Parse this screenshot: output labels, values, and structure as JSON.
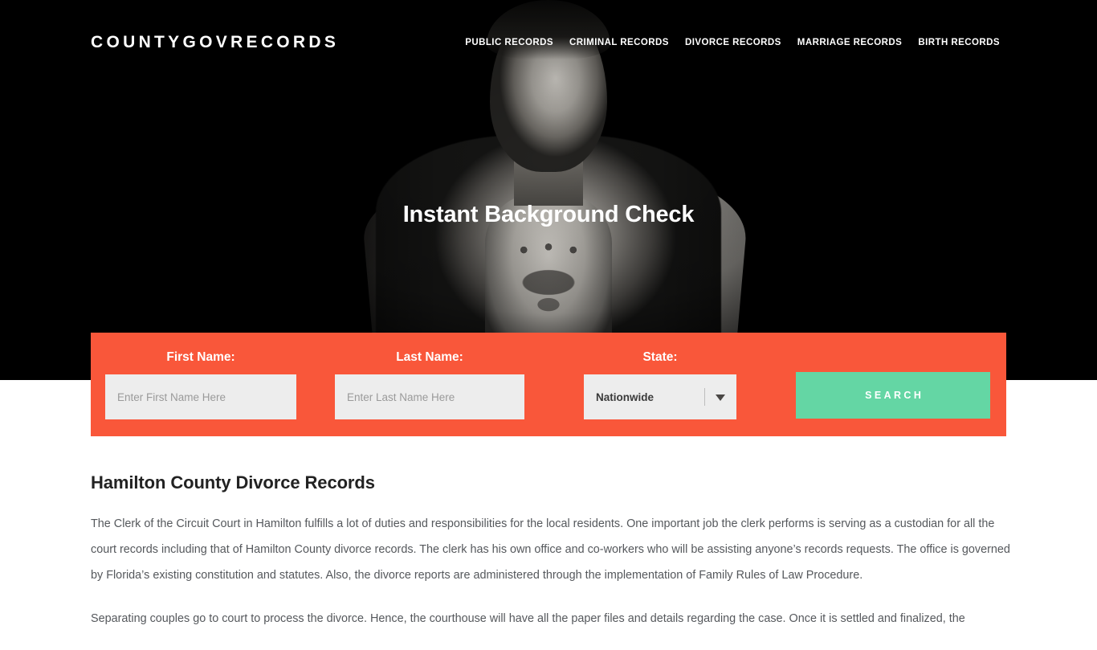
{
  "colors": {
    "hero_bg": "#000000",
    "searchbar_orange": "#f9573a",
    "search_button_green": "#64d6a4",
    "input_gray": "#ededed",
    "body_text": "#55585c",
    "heading_text": "#222222"
  },
  "header": {
    "logo": "COUNTYGOVRECORDS",
    "nav": [
      {
        "label": "PUBLIC RECORDS"
      },
      {
        "label": "CRIMINAL RECORDS"
      },
      {
        "label": "DIVORCE RECORDS"
      },
      {
        "label": "MARRIAGE RECORDS"
      },
      {
        "label": "BIRTH RECORDS"
      }
    ]
  },
  "hero": {
    "title": "Instant Background Check",
    "image_alt": "monochrome portrait of a man in a denim jacket"
  },
  "search_form": {
    "first_name": {
      "label": "First Name:",
      "placeholder": "Enter First Name Here",
      "value": ""
    },
    "last_name": {
      "label": "Last Name:",
      "placeholder": "Enter Last Name Here",
      "value": ""
    },
    "state": {
      "label": "State:",
      "selected": "Nationwide",
      "caret_icon": "chevron-down-icon"
    },
    "submit": {
      "label": "SEARCH"
    }
  },
  "article": {
    "title": "Hamilton County Divorce Records",
    "paragraphs": [
      "The Clerk of the Circuit Court in Hamilton fulfills a lot of duties and responsibilities for the local residents. One important job the clerk performs is serving as a custodian for all the court records including that of Hamilton County divorce records. The clerk has his own office and co-workers who will be assisting anyone’s records requests. The office is governed by Florida’s existing constitution and statutes. Also, the divorce reports are administered through the implementation of Family Rules of Law Procedure.",
      "Separating couples go to court to process the divorce. Hence, the courthouse will have all the paper files and details regarding the case. Once it is settled and finalized, the"
    ]
  }
}
